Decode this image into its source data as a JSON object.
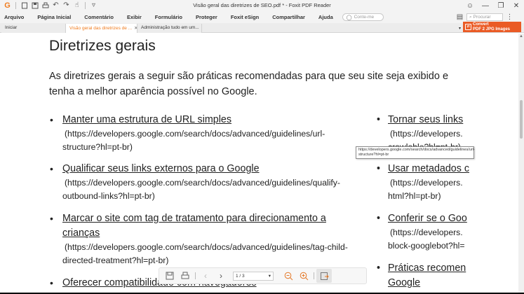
{
  "window": {
    "title": "Visão geral das diretrizes de SEO.pdf * - Foxit PDF Reader",
    "logo": "G",
    "quick_access_icons": [
      "new-icon",
      "save-icon",
      "print-icon",
      "undo-icon",
      "redo-icon",
      "hand-tool-icon",
      "customize-icon"
    ],
    "controls": [
      "account-icon",
      "minimize-icon",
      "maximize-icon",
      "close-icon"
    ]
  },
  "menu": {
    "items": [
      "Arquivo",
      "Página Inicial",
      "Comentário",
      "Exibir",
      "Formulário",
      "Proteger",
      "Foxit eSign",
      "Compartilhar",
      "Ajuda"
    ],
    "tellme_placeholder": "Conte-me",
    "search_placeholder": "Procurar"
  },
  "tabs": [
    {
      "label": "Iniciar"
    },
    {
      "label": "Visão geral das diretrizes de ..."
    },
    {
      "label": "Administração tudo em um..."
    }
  ],
  "convert_button": {
    "line1": "Convert",
    "line2": "PDF 2 JPG Images"
  },
  "document": {
    "heading": "Diretrizes gerais",
    "intro": "As diretrizes gerais a seguir são práticas recomendadas para que seu site seja exibido e tenha a melhor aparência possível no Google.",
    "col1": [
      {
        "link": "Manter uma estrutura de URL simples",
        "url1": "(https://developers.google.com/search/docs/advanced/guidelines/url-",
        "url2": "structure?hl=pt-br)"
      },
      {
        "link": "Qualificar seus links externos para o Google",
        "url1": "(https://developers.google.com/search/docs/advanced/guidelines/qualify-",
        "url2": "outbound-links?hl=pt-br)"
      },
      {
        "link": "Marcar o site com tag de tratamento para direcionamento a",
        "link2": "crianças",
        "url1": "(https://developers.google.com/search/docs/advanced/guidelines/tag-child-",
        "url2": "directed-treatment?hl=pt-br)"
      },
      {
        "link": "Oferecer compatibilidade com navegadores"
      }
    ],
    "col2": [
      {
        "link": "Tornar seus links",
        "url1": "(https://developers.",
        "url2": "crawlable?hl=pt-br)"
      },
      {
        "link": "Usar metadados c",
        "url1": "(https://developers.",
        "url2": "html?hl=pt-br)"
      },
      {
        "link": "Conferir se o Goo",
        "url1": "(https://developers.",
        "url2": "block-googlebot?hl="
      },
      {
        "link": "Práticas recomen",
        "link2": "Google"
      }
    ],
    "tooltip": "https://developers.google.com/search/docs/advanced/guidelines/url-structure?hl=pt-br"
  },
  "float_toolbar": {
    "page_indicator": "1 / 3"
  }
}
